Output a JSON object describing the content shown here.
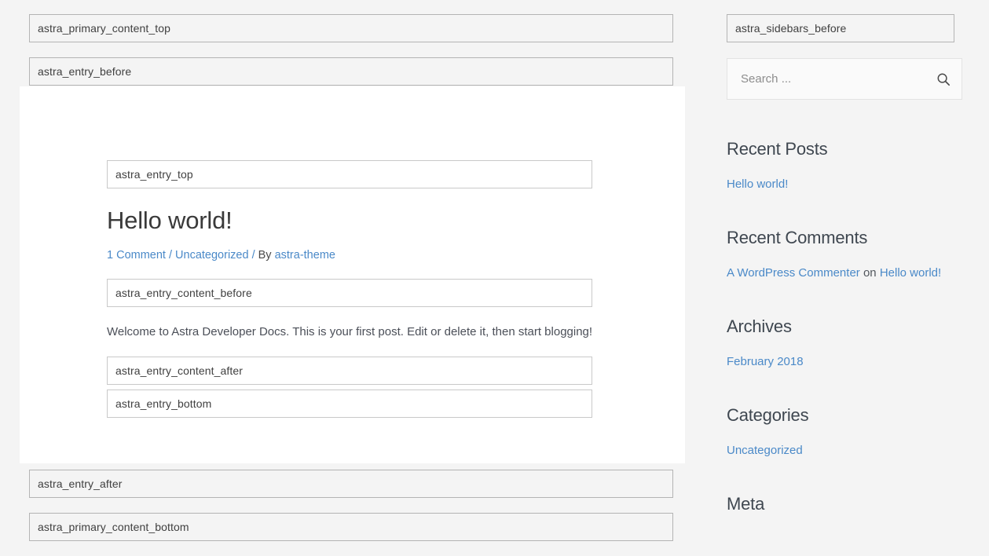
{
  "colors": {
    "page_background": "#f4f4f4",
    "card_background": "#ffffff",
    "link": "#4a89c8",
    "heading": "#3a3a3a",
    "hook_border": "#b4b4b4",
    "hook_inner_border": "#c9c9c9"
  },
  "primary": {
    "hooks_top": [
      {
        "label": "astra_primary_content_top"
      },
      {
        "label": "astra_entry_before"
      }
    ],
    "hooks_bottom": [
      {
        "label": "astra_entry_after"
      },
      {
        "label": "astra_primary_content_bottom"
      }
    ]
  },
  "entry": {
    "hook_entry_top": "astra_entry_top",
    "title": "Hello world!",
    "meta": {
      "comments": "1 Comment",
      "separator_1": "/",
      "category": "Uncategorized",
      "separator_2": "/",
      "by_prefix": "By",
      "author": "astra-theme"
    },
    "hook_content_before": "astra_entry_content_before",
    "content": "Welcome to Astra Developer Docs. This is your first post. Edit or delete it, then start blogging!",
    "hook_content_after": "astra_entry_content_after",
    "hook_entry_bottom": "astra_entry_bottom"
  },
  "sidebar": {
    "hook_before": "astra_sidebars_before",
    "search": {
      "placeholder": "Search ...",
      "value": "",
      "icon": "search-icon"
    },
    "widgets": [
      {
        "title": "Recent Posts",
        "items": [
          {
            "text": "Hello world!",
            "link": true
          }
        ]
      },
      {
        "title": "Recent Comments",
        "items": [
          {
            "author": "A WordPress Commenter",
            "on": "on",
            "post": "Hello world!"
          }
        ]
      },
      {
        "title": "Archives",
        "items": [
          {
            "text": "February 2018",
            "link": true
          }
        ]
      },
      {
        "title": "Categories",
        "items": [
          {
            "text": "Uncategorized",
            "link": true
          }
        ]
      },
      {
        "title": "Meta",
        "items": []
      }
    ]
  }
}
